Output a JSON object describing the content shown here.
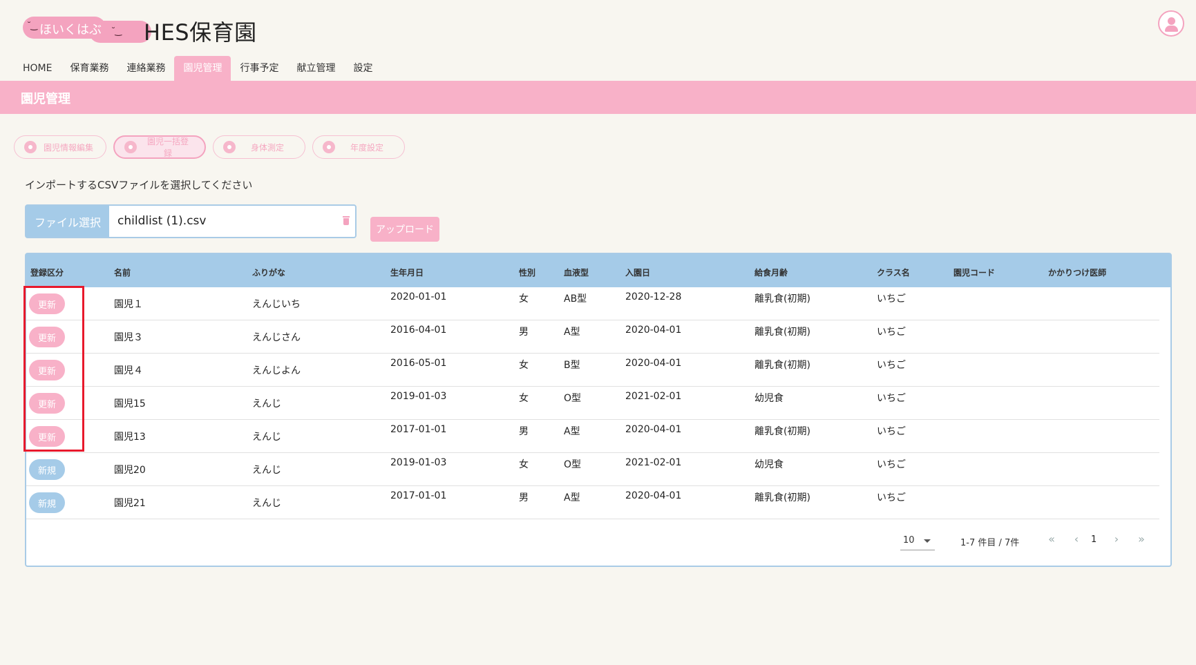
{
  "brand": {
    "logo_text": "ほいくはぶ",
    "title": "HES保育園"
  },
  "nav": {
    "items": [
      {
        "label": "HOME"
      },
      {
        "label": "保育業務"
      },
      {
        "label": "連絡業務"
      },
      {
        "label": "園児管理"
      },
      {
        "label": "行事予定"
      },
      {
        "label": "献立管理"
      },
      {
        "label": "設定"
      }
    ],
    "active_index": 3
  },
  "page": {
    "title": "園児管理"
  },
  "actions": [
    {
      "label": "園児情報編集",
      "icon": "child-icon"
    },
    {
      "label": "園児一括登録",
      "icon": "group-icon"
    },
    {
      "label": "身体測定",
      "icon": "scale-icon"
    },
    {
      "label": "年度設定",
      "icon": "flower-icon"
    }
  ],
  "import": {
    "instruction": "インポートするCSVファイルを選択してください",
    "file_button": "ファイル選択",
    "file_name": "childlist (1).csv",
    "upload_button": "アップロード"
  },
  "table": {
    "columns": [
      "登録区分",
      "名前",
      "ふりがな",
      "生年月日",
      "性別",
      "血液型",
      "入園日",
      "給食月齢",
      "クラス名",
      "園児コード",
      "かかりつけ医師"
    ],
    "rows": [
      {
        "status": "更新",
        "type": "update",
        "name": "園児１",
        "kana": "えんじいち",
        "birth": "2020-01-01",
        "sex": "女",
        "blood": "AB型",
        "entry": "2020-12-28",
        "meal": "離乳食(初期)",
        "class": "いちご",
        "code": "",
        "doctor": ""
      },
      {
        "status": "更新",
        "type": "update",
        "name": "園児３",
        "kana": "えんじさん",
        "birth": "2016-04-01",
        "sex": "男",
        "blood": "A型",
        "entry": "2020-04-01",
        "meal": "離乳食(初期)",
        "class": "いちご",
        "code": "",
        "doctor": ""
      },
      {
        "status": "更新",
        "type": "update",
        "name": "園児４",
        "kana": "えんじよん",
        "birth": "2016-05-01",
        "sex": "女",
        "blood": "B型",
        "entry": "2020-04-01",
        "meal": "離乳食(初期)",
        "class": "いちご",
        "code": "",
        "doctor": ""
      },
      {
        "status": "更新",
        "type": "update",
        "name": "園児15",
        "kana": "えんじ",
        "birth": "2019-01-03",
        "sex": "女",
        "blood": "O型",
        "entry": "2021-02-01",
        "meal": "幼児食",
        "class": "いちご",
        "code": "",
        "doctor": ""
      },
      {
        "status": "更新",
        "type": "update",
        "name": "園児13",
        "kana": "えんじ",
        "birth": "2017-01-01",
        "sex": "男",
        "blood": "A型",
        "entry": "2020-04-01",
        "meal": "離乳食(初期)",
        "class": "いちご",
        "code": "",
        "doctor": ""
      },
      {
        "status": "新規",
        "type": "new",
        "name": "園児20",
        "kana": "えんじ",
        "birth": "2019-01-03",
        "sex": "女",
        "blood": "O型",
        "entry": "2021-02-01",
        "meal": "幼児食",
        "class": "いちご",
        "code": "",
        "doctor": ""
      },
      {
        "status": "新規",
        "type": "new",
        "name": "園児21",
        "kana": "えんじ",
        "birth": "2017-01-01",
        "sex": "男",
        "blood": "A型",
        "entry": "2020-04-01",
        "meal": "離乳食(初期)",
        "class": "いちご",
        "code": "",
        "doctor": ""
      }
    ]
  },
  "pagination": {
    "per_page": "10",
    "range": "1-7 件目 / 7件",
    "current_page": "1",
    "first": "«",
    "prev": "‹",
    "next": "›",
    "last": "»"
  },
  "colors": {
    "pink": "#f8b1c8",
    "blue": "#a5cbe8",
    "highlight": "#e8192c"
  }
}
